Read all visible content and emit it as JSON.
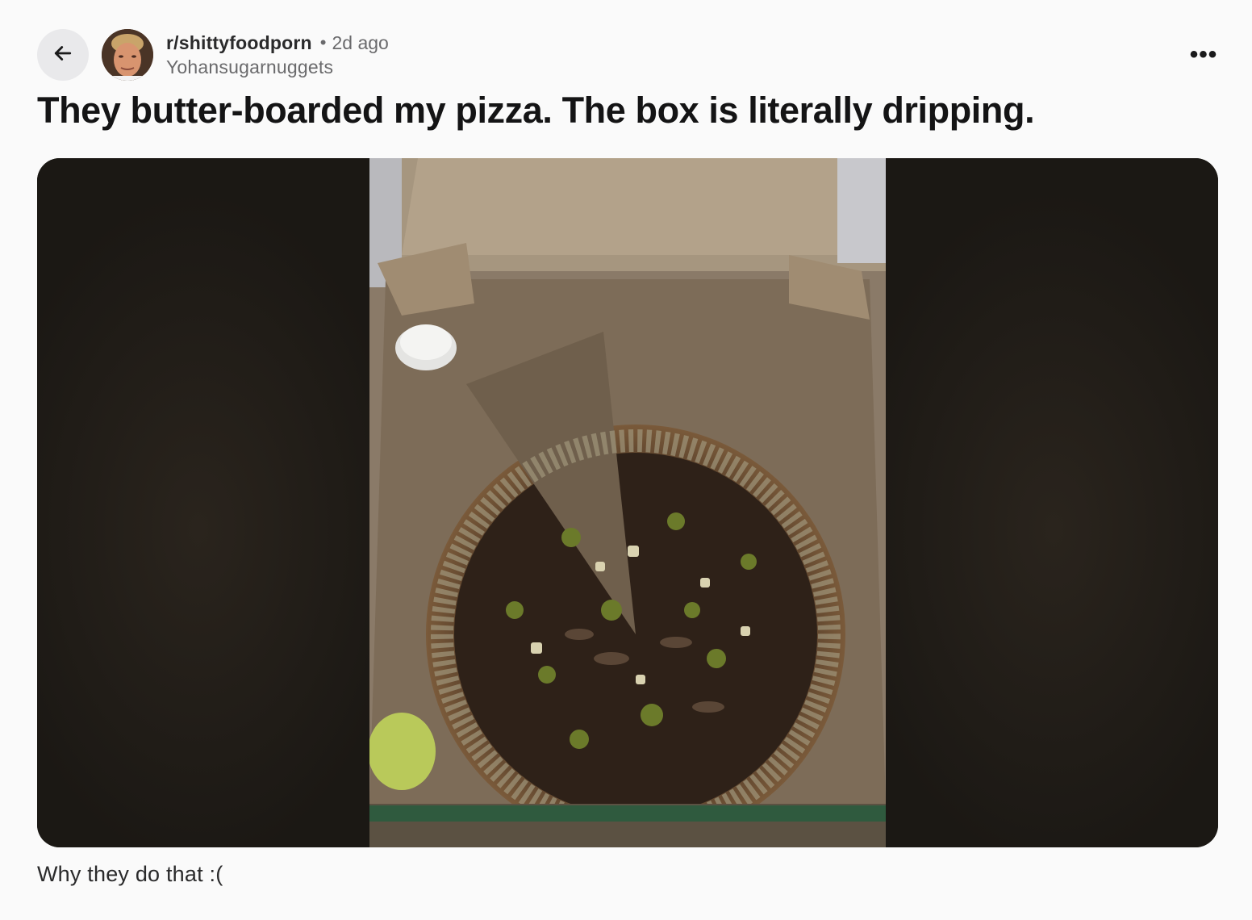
{
  "post": {
    "subreddit": "r/shittyfoodporn",
    "separator": "•",
    "time_ago": "2d ago",
    "author": "Yohansugarnuggets",
    "title": "They butter-boarded my pizza. The box is literally dripping.",
    "body": "Why they do that :("
  },
  "icons": {
    "back": "arrow-left-icon",
    "more": "more-horizontal-icon"
  },
  "colors": {
    "background": "#fafafa",
    "back_button_bg": "#e9e9eb",
    "media_frame": "#1b1814"
  }
}
